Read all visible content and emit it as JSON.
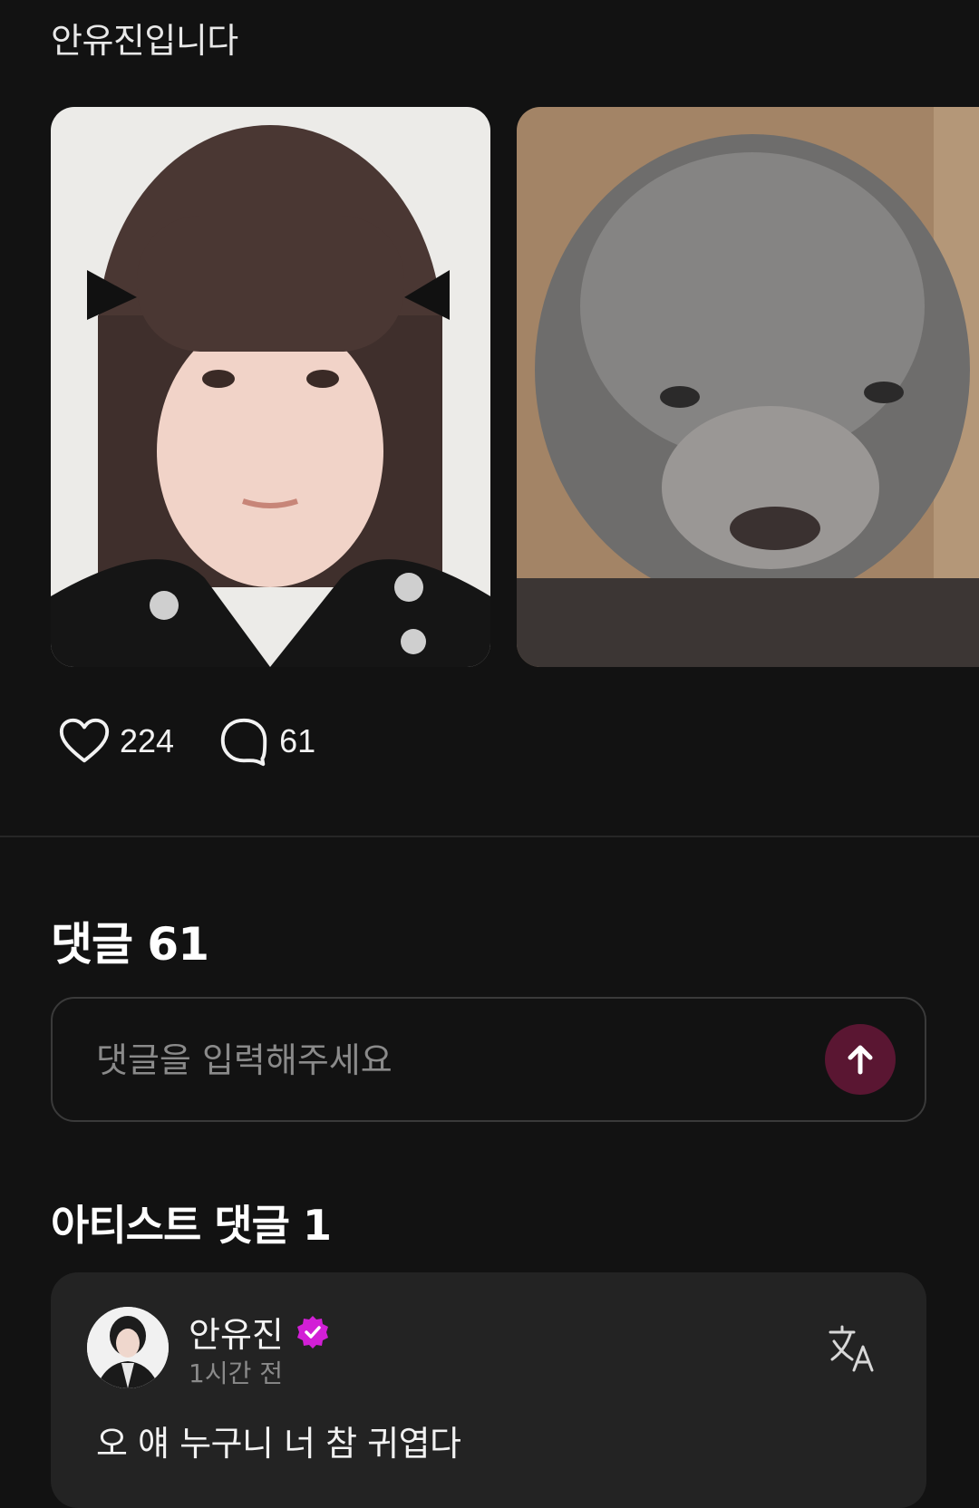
{
  "post": {
    "title": "안유진입니다"
  },
  "stats": {
    "likes": "224",
    "comments": "61"
  },
  "comments_section": {
    "heading": "댓글 61",
    "input_placeholder": "댓글을 입력해주세요"
  },
  "artist_comments": {
    "heading": "아티스트 댓글 1",
    "items": [
      {
        "author": "안유진",
        "time": "1시간 전",
        "text": "오 얘 누구니 너 참 귀엽다"
      }
    ]
  },
  "colors": {
    "background": "#121212",
    "card": "#232323",
    "send_button": "#5a1632",
    "verified_badge": "#d21fd6"
  },
  "icons": {
    "like": "heart-icon",
    "comment": "speech-bubble-icon",
    "send": "arrow-up-icon",
    "verified": "verified-badge-icon",
    "translate": "translate-icon"
  }
}
